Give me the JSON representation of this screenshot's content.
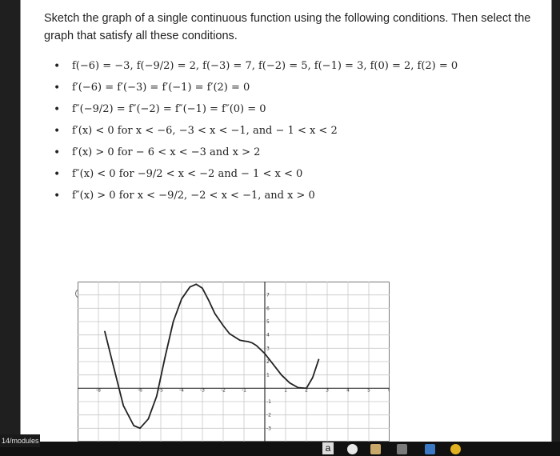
{
  "question": {
    "text": "Sketch the graph of a single continuous function using the following conditions. Then select the graph that satisfy all these conditions."
  },
  "conditions": [
    "f(−6) = −3, f(−9/2) = 2, f(−3) = 7, f(−2) = 5, f(−1) = 3, f(0) = 2, f(2) = 0",
    "f′(−6) = f′(−3) = f′(−1) = f′(2) = 0",
    "f″(−9/2) = f″(−2) = f″(−1) = f″(0) = 0",
    "f′(x) < 0 for x < −6, −3 < x < −1, and − 1 < x < 2",
    "f′(x) > 0 for − 6 < x < −3 and x > 2",
    "f″(x) < 0 for −9/2 < x < −2 and − 1 < x < 0",
    "f″(x) > 0 for x < −9/2, −2 < x < −1, and x > 0"
  ],
  "bullet": "•",
  "chart_data": {
    "type": "line",
    "xlim": [
      -9,
      6
    ],
    "ylim": [
      -4,
      8
    ],
    "grid": true,
    "x_ticks": [
      "-8",
      "-6",
      "-5",
      "-4",
      "-3",
      "-2",
      "-1",
      "1",
      "2",
      "3",
      "4",
      "5",
      "6"
    ],
    "y_ticks": [
      "-3",
      "-2",
      "-1",
      "1",
      "2",
      "3",
      "4",
      "5",
      "6",
      "7"
    ],
    "x_tick_values": [
      -8,
      -6,
      -5,
      -4,
      -3,
      -2,
      -1,
      1,
      2,
      3,
      4,
      5,
      6
    ],
    "y_tick_values": [
      -3,
      -2,
      -1,
      1,
      2,
      3,
      4,
      5,
      6,
      7
    ],
    "series": [
      {
        "x": [
          -7.7,
          -7.3,
          -6.8,
          -6.3,
          -6.0,
          -5.6,
          -5.2,
          -4.8,
          -4.4,
          -4.0,
          -3.6,
          -3.3,
          -3.0,
          -2.7,
          -2.4,
          -2.0,
          -1.7,
          -1.4,
          -1.2,
          -1.0,
          -0.8,
          -0.6,
          -0.4,
          0.0,
          0.4,
          0.8,
          1.2,
          1.6,
          2.0,
          2.3,
          2.6
        ],
        "y": [
          4.3,
          1.8,
          -1.3,
          -2.8,
          -3.0,
          -2.3,
          -0.6,
          2.3,
          5.0,
          6.7,
          7.6,
          7.8,
          7.5,
          6.6,
          5.6,
          4.7,
          4.1,
          3.8,
          3.6,
          3.55,
          3.5,
          3.4,
          3.2,
          2.6,
          1.8,
          1.0,
          0.4,
          0.05,
          0.0,
          0.8,
          2.2
        ],
        "color": "#222222"
      }
    ]
  },
  "taskbar": {
    "modules_label": "14/modules",
    "app_letter": "a"
  },
  "colors": {
    "grid": "#c8c8c8",
    "axis": "#333333",
    "curve": "#222222",
    "plot_border": "#444444"
  }
}
